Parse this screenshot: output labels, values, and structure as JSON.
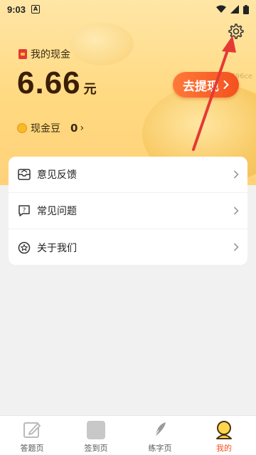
{
  "status_bar": {
    "time": "9:03",
    "notification_icon": "A"
  },
  "header": {
    "wallet_title": "我的现金",
    "amount": "6.66",
    "amount_unit": "元",
    "withdraw_label": "去提现",
    "watermark": "0796ce",
    "beans_label": "现金豆",
    "beans_count": "0"
  },
  "menu": {
    "items": [
      {
        "label": "意见反馈",
        "icon": "feedback-icon"
      },
      {
        "label": "常见问题",
        "icon": "question-icon"
      },
      {
        "label": "关于我们",
        "icon": "about-icon"
      }
    ]
  },
  "tabs": [
    {
      "label": "答题页",
      "icon": "edit-icon"
    },
    {
      "label": "签到页",
      "icon": "checkin-icon"
    },
    {
      "label": "练字页",
      "icon": "pen-icon"
    },
    {
      "label": "我的",
      "icon": "profile-icon",
      "active": true
    }
  ],
  "colors": {
    "accent": "#f4511e",
    "hero": "#ffd980",
    "annotation_arrow": "#e53935"
  }
}
